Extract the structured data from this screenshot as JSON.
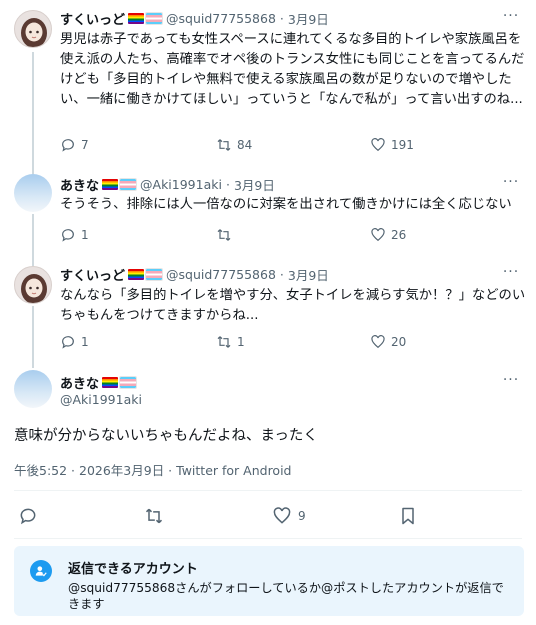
{
  "tweets": [
    {
      "name": "すくいっど",
      "handle": "@squid77755868",
      "date": "3月9日",
      "text": "男児は赤子であっても女性スペースに連れてくるな多目的トイレや家族風呂を使え派の人たち、高確率でオペ後のトランス女性にも同じことを言ってるんだけども「多目的トイレや無料で使える家族風呂の数が足りないので増やしたい、一緒に働きかけてほしい」っていうと「なんで私が」って言い出すのね...",
      "replies": "7",
      "retweets": "84",
      "likes": "191"
    },
    {
      "name": "あきな",
      "handle": "@Aki1991aki",
      "date": "3月9日",
      "text": "そうそう、排除には人一倍なのに対案を出されて働きかけには全く応じない",
      "replies": "1",
      "retweets": "",
      "likes": "26"
    },
    {
      "name": "すくいっど",
      "handle": "@squid77755868",
      "date": "3月9日",
      "text": "なんなら「多目的トイレを増やす分、女子トイレを減らす気か！？」などのいちゃもんをつけてきますからね...",
      "replies": "1",
      "retweets": "1",
      "likes": "20"
    }
  ],
  "focus": {
    "name": "あきな",
    "handle": "@Aki1991aki",
    "text": "意味が分からないいちゃもんだよね、まったく",
    "meta": "午後5:52 · 2026年3月9日 · Twitter for Android",
    "likes": "9"
  },
  "separator": "·",
  "more_glyph": "···",
  "reply_settings": {
    "title": "返信できるアカウント",
    "description": "@squid77755868さんがフォローしているか@ポストしたアカウントが返信できます"
  },
  "colors": {
    "accent": "#1d9bf0",
    "muted": "#536471"
  }
}
